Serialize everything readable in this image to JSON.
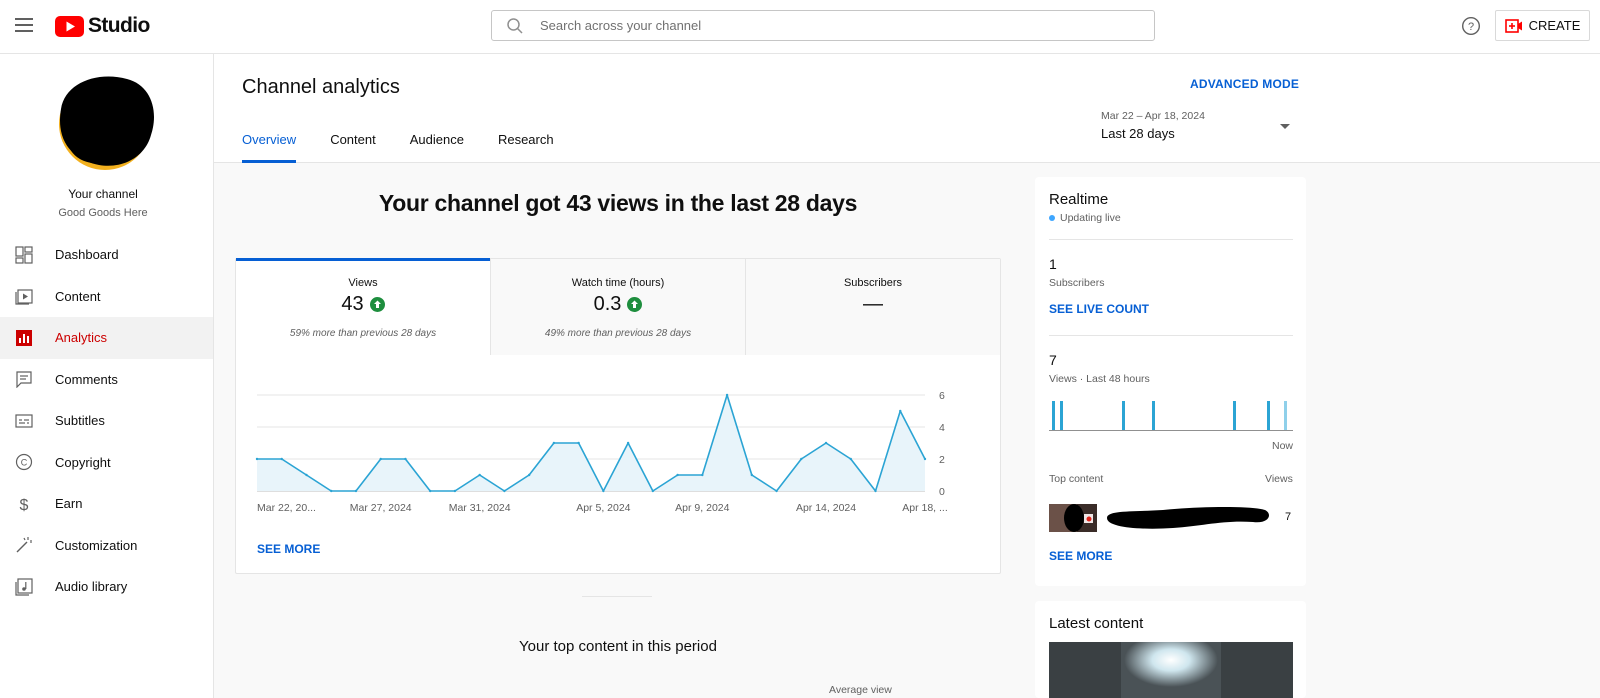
{
  "app": {
    "brand": "Studio"
  },
  "search": {
    "placeholder": "Search across your channel"
  },
  "header_actions": {
    "create_label": "CREATE"
  },
  "channel": {
    "name": "Your channel",
    "handle": "Good Goods Here"
  },
  "sidebar": {
    "items": [
      {
        "label": "Dashboard",
        "icon": "dashboard-icon",
        "active": false
      },
      {
        "label": "Content",
        "icon": "content-icon",
        "active": false
      },
      {
        "label": "Analytics",
        "icon": "analytics-icon",
        "active": true
      },
      {
        "label": "Comments",
        "icon": "comments-icon",
        "active": false
      },
      {
        "label": "Subtitles",
        "icon": "subtitles-icon",
        "active": false
      },
      {
        "label": "Copyright",
        "icon": "copyright-icon",
        "active": false
      },
      {
        "label": "Earn",
        "icon": "earn-icon",
        "active": false
      },
      {
        "label": "Customization",
        "icon": "customization-icon",
        "active": false
      },
      {
        "label": "Audio library",
        "icon": "audio-library-icon",
        "active": false
      }
    ]
  },
  "page": {
    "title": "Channel analytics",
    "advanced_mode": "ADVANCED MODE",
    "tabs": [
      {
        "label": "Overview",
        "active": true
      },
      {
        "label": "Content",
        "active": false
      },
      {
        "label": "Audience",
        "active": false
      },
      {
        "label": "Research",
        "active": false
      }
    ],
    "date_range": "Mar 22 – Apr 18, 2024",
    "date_label": "Last 28 days"
  },
  "overview": {
    "headline": "Your channel got 43 views in the last 28 days",
    "metrics": [
      {
        "name": "Views",
        "value": "43",
        "trend": "up",
        "compare": "59% more than previous 28 days"
      },
      {
        "name": "Watch time (hours)",
        "value": "0.3",
        "trend": "up",
        "compare": "49% more than previous 28 days"
      },
      {
        "name": "Subscribers",
        "value": "—",
        "trend": "",
        "compare": ""
      }
    ],
    "see_more": "SEE MORE",
    "top_content_title": "Your top content in this period",
    "average_view_label": "Average view"
  },
  "chart_data": {
    "type": "area",
    "title": "",
    "xlabel": "",
    "ylabel": "",
    "x": [
      "Mar 22",
      "Mar 23",
      "Mar 24",
      "Mar 25",
      "Mar 26",
      "Mar 27",
      "Mar 28",
      "Mar 29",
      "Mar 30",
      "Mar 31",
      "Apr 1",
      "Apr 2",
      "Apr 3",
      "Apr 4",
      "Apr 5",
      "Apr 6",
      "Apr 7",
      "Apr 8",
      "Apr 9",
      "Apr 10",
      "Apr 11",
      "Apr 12",
      "Apr 13",
      "Apr 14",
      "Apr 15",
      "Apr 16",
      "Apr 17",
      "Apr 18"
    ],
    "series": [
      {
        "values": [
          2,
          2,
          1,
          0,
          0,
          2,
          2,
          0,
          0,
          1,
          0,
          1,
          3,
          3,
          0,
          3,
          0,
          1,
          1,
          6,
          1,
          0,
          2,
          3,
          2,
          0,
          5,
          2
        ]
      }
    ],
    "tick_labels": [
      {
        "index": 0,
        "label": "Mar 22, 20..."
      },
      {
        "index": 5,
        "label": "Mar 27, 2024"
      },
      {
        "index": 9,
        "label": "Mar 31, 2024"
      },
      {
        "index": 14,
        "label": "Apr 5, 2024"
      },
      {
        "index": 18,
        "label": "Apr 9, 2024"
      },
      {
        "index": 23,
        "label": "Apr 14, 2024"
      },
      {
        "index": 27,
        "label": "Apr 18, ..."
      }
    ],
    "y_ticks": [
      0,
      2,
      4,
      6
    ],
    "ylim": [
      0,
      6
    ],
    "grid": true,
    "color": "#2ba4d4",
    "fill_color": "#e8f4fa"
  },
  "realtime": {
    "title": "Realtime",
    "live_label": "Updating live",
    "subscribers_value": "1",
    "subscribers_label": "Subscribers",
    "see_live_count": "SEE LIVE COUNT",
    "views_value": "7",
    "views_label": "Views · Last 48 hours",
    "now_label": "Now",
    "top_content_label": "Top content",
    "views_column_label": "Views",
    "top_item_views": "7",
    "see_more": "SEE MORE"
  },
  "latest": {
    "title": "Latest content"
  },
  "colors": {
    "accent": "#065fd4",
    "brand_red": "#ff0000",
    "active_nav": "#cc0000",
    "positive": "#1e8e3e",
    "chart_line": "#2ba4d4"
  }
}
